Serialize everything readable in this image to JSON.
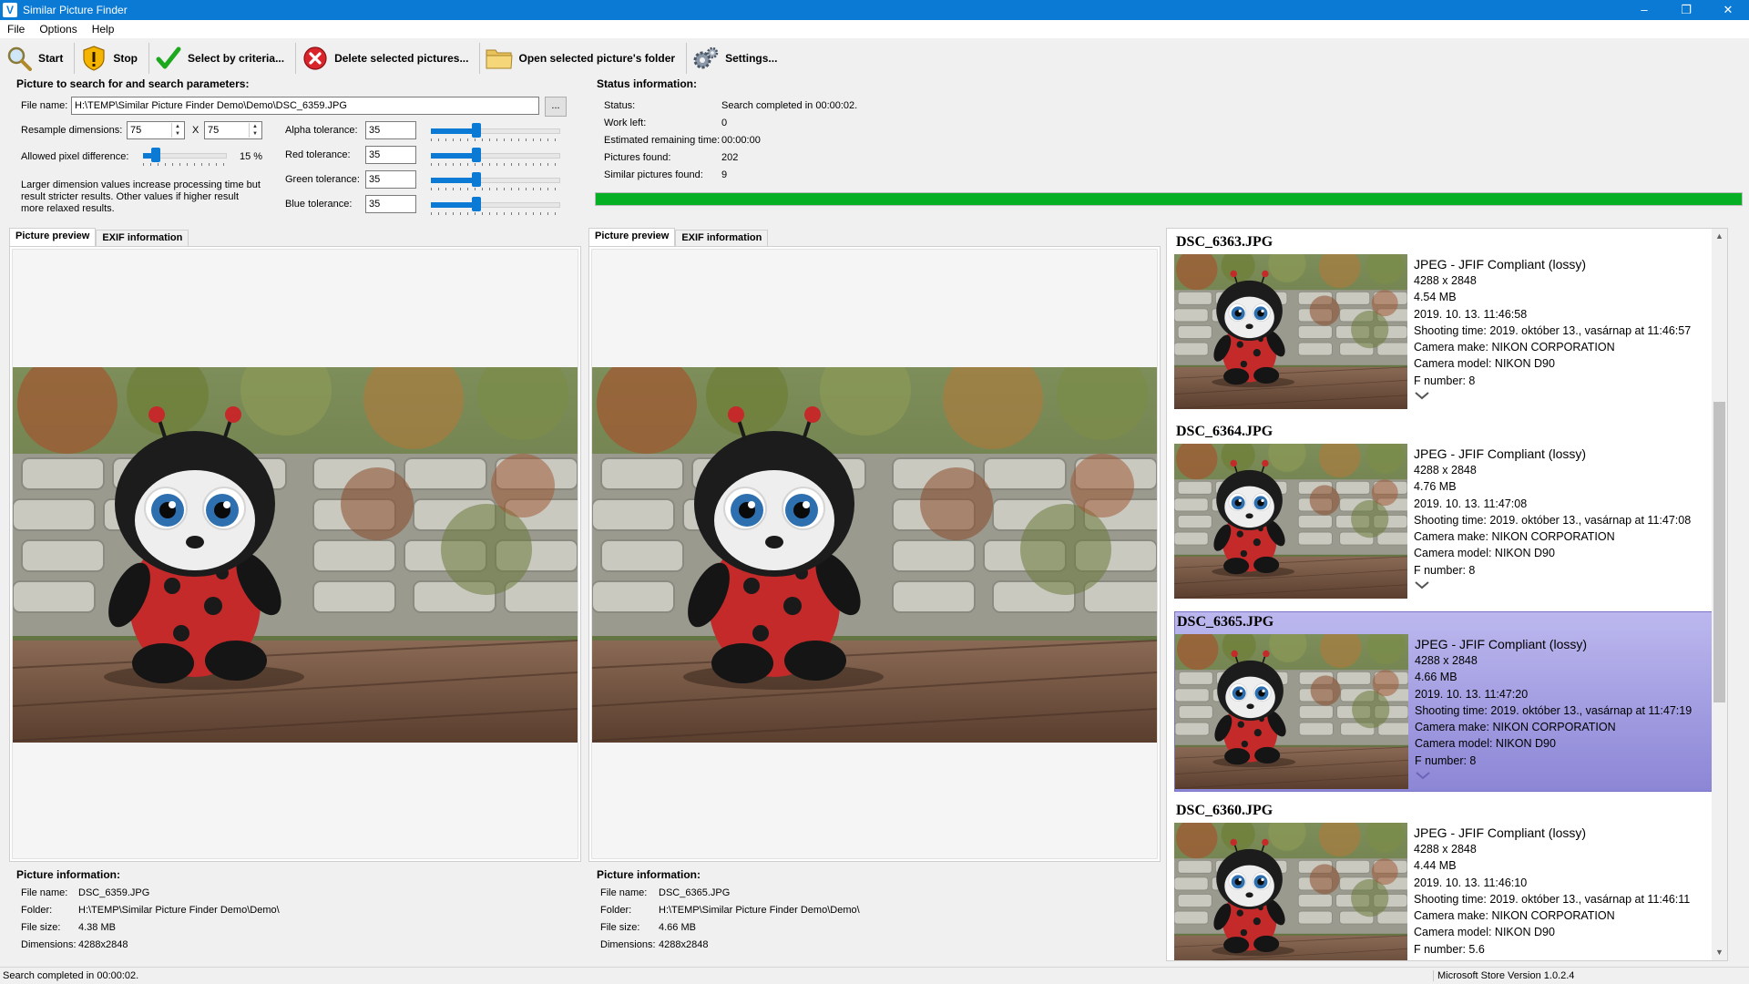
{
  "window": {
    "title": "Similar Picture Finder",
    "app_icon": "V"
  },
  "menu": [
    "File",
    "Options",
    "Help"
  ],
  "toolbar": {
    "start": "Start",
    "stop": "Stop",
    "select": "Select by criteria...",
    "delete": "Delete selected pictures...",
    "open_folder": "Open selected picture's folder",
    "settings": "Settings..."
  },
  "search": {
    "title": "Picture to search for and search parameters:",
    "file_name_label": "File name:",
    "file_name": "H:\\TEMP\\Similar Picture Finder Demo\\Demo\\DSC_6359.JPG",
    "browse": "...",
    "resample_label": "Resample dimensions:",
    "resample_w": "75",
    "resample_x": "X",
    "resample_h": "75",
    "pixel_diff_label": "Allowed pixel difference:",
    "pixel_diff_value": "15 %",
    "pixel_diff_percent": 15,
    "hint": "Larger dimension values increase processing time but result stricter results. Other values if higher result more relaxed results.",
    "alpha_label": "Alpha tolerance:",
    "alpha": "35",
    "red_label": "Red tolerance:",
    "red": "35",
    "green_label": "Green tolerance:",
    "green": "35",
    "blue_label": "Blue tolerance:",
    "blue": "35",
    "tolerance_fraction": 0.35
  },
  "status": {
    "title": "Status information:",
    "status_label": "Status:",
    "status": "Search completed in 00:00:02.",
    "work_left_label": "Work left:",
    "work_left": "0",
    "remaining_label": "Estimated remaining time:",
    "remaining": "00:00:00",
    "pictures_found_label": "Pictures found:",
    "pictures_found": "202",
    "similar_label": "Similar pictures found:",
    "similar": "9",
    "progress_percent": 100
  },
  "tabs": {
    "preview": "Picture preview",
    "exif": "EXIF information"
  },
  "left_info": {
    "title": "Picture information:",
    "file_name_label": "File name:",
    "file_name": "DSC_6359.JPG",
    "folder_label": "Folder:",
    "folder": "H:\\TEMP\\Similar Picture Finder Demo\\Demo\\",
    "size_label": "File size:",
    "size": "4.38 MB",
    "dim_label": "Dimensions:",
    "dim": "4288x2848"
  },
  "right_info": {
    "title": "Picture information:",
    "file_name_label": "File name:",
    "file_name": "DSC_6365.JPG",
    "folder_label": "Folder:",
    "folder": "H:\\TEMP\\Similar Picture Finder Demo\\Demo\\",
    "size_label": "File size:",
    "size": "4.66 MB",
    "dim_label": "Dimensions:",
    "dim": "4288x2848"
  },
  "results": [
    {
      "name": "DSC_6363.JPG",
      "format": "JPEG - JFIF Compliant (lossy)",
      "dims": "4288 x 2848",
      "size": "4.54 MB",
      "date": "2019. 10. 13. 11:46:58",
      "shooting": "Shooting time: 2019. október 13., vasárnap at 11:46:57",
      "make": "Camera make: NIKON CORPORATION",
      "model": "Camera model: NIKON D90",
      "fnum": "F number: 8"
    },
    {
      "name": "DSC_6364.JPG",
      "format": "JPEG - JFIF Compliant (lossy)",
      "dims": "4288 x 2848",
      "size": "4.76 MB",
      "date": "2019. 10. 13. 11:47:08",
      "shooting": "Shooting time: 2019. október 13., vasárnap at 11:47:08",
      "make": "Camera make: NIKON CORPORATION",
      "model": "Camera model: NIKON D90",
      "fnum": "F number: 8"
    },
    {
      "name": "DSC_6365.JPG",
      "format": "JPEG - JFIF Compliant (lossy)",
      "dims": "4288 x 2848",
      "size": "4.66 MB",
      "date": "2019. 10. 13. 11:47:20",
      "shooting": "Shooting time: 2019. október 13., vasárnap at 11:47:19",
      "make": "Camera make: NIKON CORPORATION",
      "model": "Camera model: NIKON D90",
      "fnum": "F number: 8"
    },
    {
      "name": "DSC_6360.JPG",
      "format": "JPEG - JFIF Compliant (lossy)",
      "dims": "4288 x 2848",
      "size": "4.44 MB",
      "date": "2019. 10. 13. 11:46:10",
      "shooting": "Shooting time: 2019. október 13., vasárnap at 11:46:11",
      "make": "Camera make: NIKON CORPORATION",
      "model": "Camera model: NIKON D90",
      "fnum": "F number: 5.6"
    }
  ],
  "statusbar": {
    "left": "Search completed in 00:00:02.",
    "right": "Microsoft Store Version 1.0.2.4"
  },
  "icons": {
    "start": "magnifier-icon",
    "stop": "shield-warning-icon",
    "select": "checkmark-icon",
    "delete": "red-x-icon",
    "open_folder": "folder-icon",
    "settings": "gears-icon"
  },
  "colors": {
    "titlebar": "#0a7ad4",
    "progress": "#06b025",
    "selected": "#a9a4e2",
    "slider": "#0a7ad4"
  }
}
